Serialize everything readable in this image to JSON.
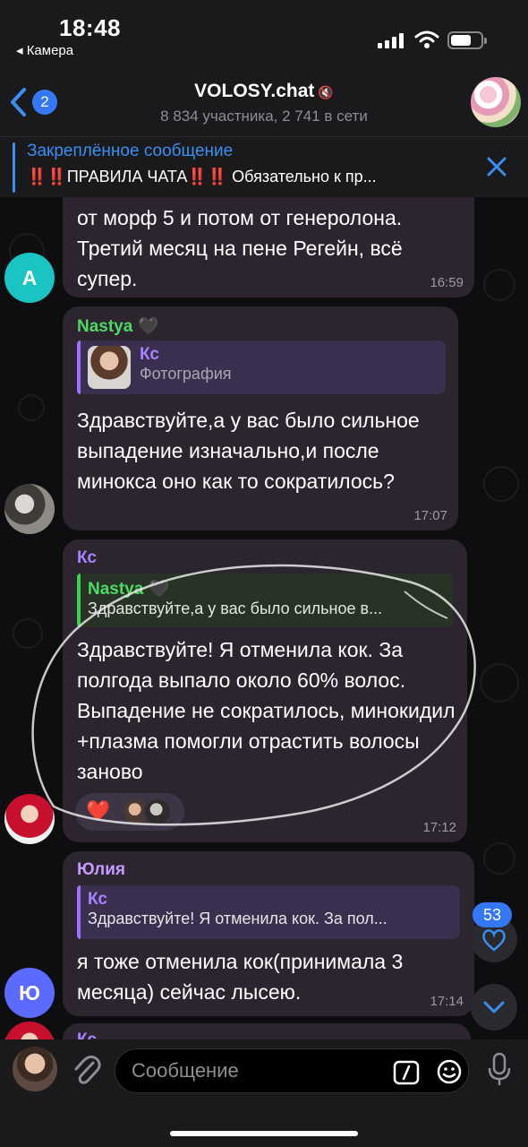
{
  "status_bar": {
    "time": "18:48",
    "back_app": "◂ Камера"
  },
  "header": {
    "back_count": "2",
    "title": "VOLOSY.chat",
    "subtitle": "8 834 участника, 2 741 в сети"
  },
  "pinned": {
    "title": "Закреплённое сообщение",
    "text": "‼️‼️ПРАВИЛА ЧАТА‼️‼️ Обязательно к пр..."
  },
  "messages": [
    {
      "text": "от морф 5 и потом от генеролона. Третий месяц на пене Регейн, всё супер.",
      "time": "16:59",
      "avatar_letter": "A"
    },
    {
      "sender": "Nastya 🖤",
      "reply_name": "Кс",
      "reply_text": "Фотография",
      "text": "Здравствуйте,а у вас было сильное выпадение изначально,и после минокса оно как то сократилось?",
      "time": "17:07"
    },
    {
      "sender": "Кс",
      "reply_name": "Nastya 🖤",
      "reply_text": "Здравствуйте,а у вас было сильное в...",
      "text": "Здравствуйте! Я отменила кок. За полгода выпало около 60% волос. Выпадение не сократилось, минокидил +плазма помогли отрастить волосы заново",
      "reaction": "❤️",
      "time": "17:12"
    },
    {
      "sender": "Юлия",
      "reply_name": "Кс",
      "reply_text": "Здравствуйте! Я отменила кок. За пол...",
      "text": "я тоже отменила кок(принимала 3 месяца)  сейчас лысею.",
      "time": "17:14",
      "avatar_letter": "Ю"
    },
    {
      "sender": "Кс"
    }
  ],
  "unread_reactions": "53",
  "input": {
    "placeholder": "Сообщение"
  },
  "colors": {
    "accent": "#3478f6",
    "nastya_name": "#4cd964",
    "ks_name": "#a982ff",
    "yulia_name": "#c49bff",
    "bubble": "#2c2530"
  }
}
